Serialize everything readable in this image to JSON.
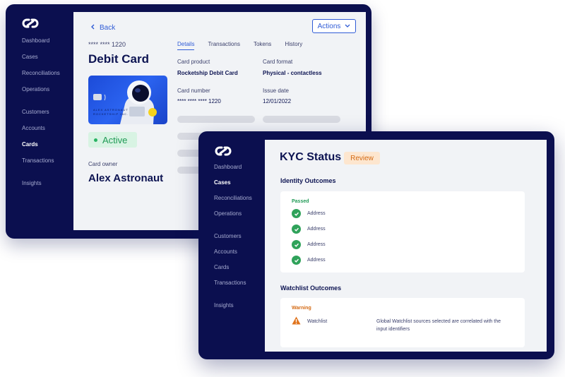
{
  "back_window": {
    "nav": {
      "items": [
        "Dashboard",
        "Cases",
        "Reconciliations",
        "Operations",
        "Customers",
        "Accounts",
        "Cards",
        "Transactions",
        "Insights"
      ],
      "active": "Cards"
    },
    "back_label": "Back",
    "actions_label": "Actions",
    "card_number_masked": "**** **** 1220",
    "card_title": "Debit Card",
    "card_art_text": [
      "ALEX ASTRONAUT",
      "ROCKETSHIP INC."
    ],
    "status": "Active",
    "owner_label": "Card owner",
    "owner_name": "Alex Astronaut",
    "tabs": [
      "Details",
      "Transactions",
      "Tokens",
      "History"
    ],
    "active_tab": "Details",
    "fields": {
      "card_product_label": "Card product",
      "card_product_value": "Rocketship Debit Card",
      "card_format_label": "Card format",
      "card_format_value": "Physical - contactless",
      "card_number_label": "Card number",
      "card_number_value": "**** **** **** 1220",
      "issue_date_label": "Issue date",
      "issue_date_value": "12/01/2022"
    }
  },
  "front_window": {
    "nav": {
      "items": [
        "Dashboard",
        "Cases",
        "Reconciliations",
        "Operations",
        "Customers",
        "Accounts",
        "Cards",
        "Transactions",
        "Insights"
      ],
      "active": "Cases"
    },
    "title": "KYC Status",
    "badge": "Review",
    "identity": {
      "title": "Identity Outcomes",
      "status": "Passed",
      "items": [
        "Address",
        "Address",
        "Address",
        "Address"
      ]
    },
    "watchlist": {
      "title": "Watchlist Outcomes",
      "status": "Warning",
      "item_label": "Watchlist",
      "item_description": "Global Watchlist sources selected are correlated with the input identifiers"
    }
  },
  "colors": {
    "navy": "#0b0f4f",
    "accent_blue": "#2f5bd6",
    "success_green": "#2fa25a",
    "warning_orange": "#e0731c",
    "panel_bg": "#f1f3f6"
  },
  "icons": [
    "logo-icon",
    "chevron-left-icon",
    "chevron-down-icon",
    "check-circle-icon",
    "warning-triangle-icon"
  ]
}
